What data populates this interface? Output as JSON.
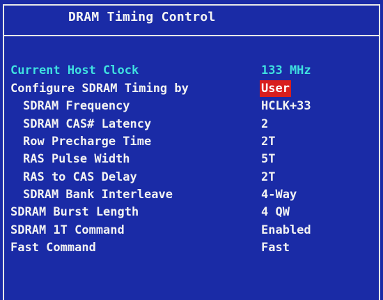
{
  "header": {
    "title": "DRAM Timing Control"
  },
  "info": {
    "host_clock_label": "Current Host Clock",
    "host_clock_value": "133 MHz"
  },
  "settings": [
    {
      "label": "Configure SDRAM Timing by",
      "value": "User",
      "selected": true
    },
    {
      "label": "SDRAM Frequency",
      "value": "HCLK+33"
    },
    {
      "label": "SDRAM CAS# Latency",
      "value": "2"
    },
    {
      "label": "Row Precharge Time",
      "value": "2T"
    },
    {
      "label": "RAS Pulse Width",
      "value": "5T"
    },
    {
      "label": "RAS to CAS Delay",
      "value": "2T"
    },
    {
      "label": "SDRAM Bank Interleave",
      "value": "4-Way"
    },
    {
      "label": "SDRAM Burst Length",
      "value": "4 QW"
    },
    {
      "label": "SDRAM 1T Command",
      "value": "Enabled"
    },
    {
      "label": "Fast Command",
      "value": "Fast"
    }
  ],
  "colors": {
    "background": "#1a2ba6",
    "text": "#f2f2f2",
    "info_text": "#3fe0e0",
    "highlight": "#d81e1e"
  }
}
